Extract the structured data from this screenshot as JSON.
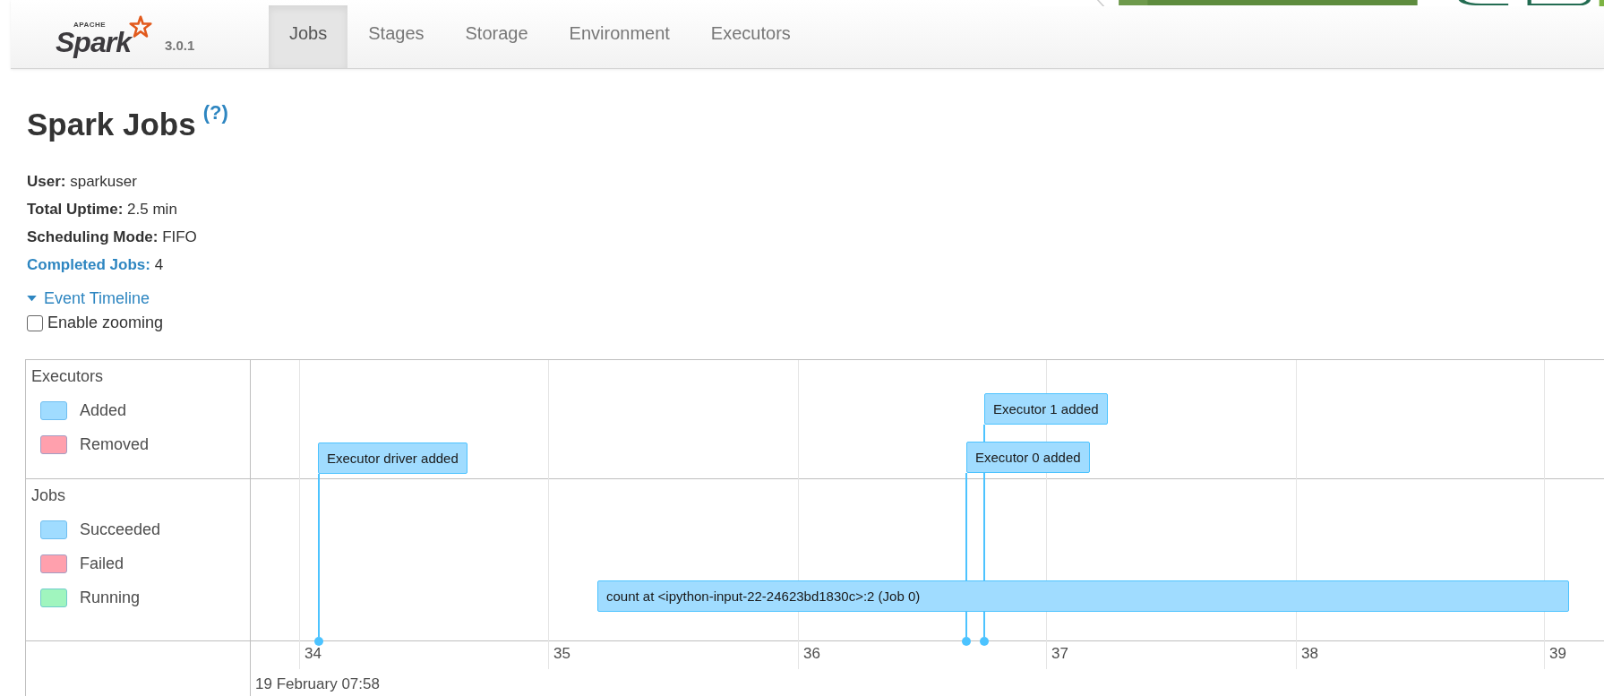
{
  "navbar": {
    "brand": {
      "apache": "APACHE",
      "name": "Spark",
      "version": "3.0.1"
    },
    "tabs": [
      {
        "label": "Jobs",
        "selected": true
      },
      {
        "label": "Stages",
        "selected": false
      },
      {
        "label": "Storage",
        "selected": false
      },
      {
        "label": "Environment",
        "selected": false
      },
      {
        "label": "Executors",
        "selected": false
      }
    ]
  },
  "page": {
    "title": "Spark Jobs",
    "help": "(?)",
    "summary": [
      {
        "label": "User:",
        "value": "sparkuser",
        "kind": "plain"
      },
      {
        "label": "Total Uptime:",
        "value": "2.5 min",
        "kind": "plain"
      },
      {
        "label": "Scheduling Mode:",
        "value": "FIFO",
        "kind": "plain"
      },
      {
        "label": "Completed Jobs:",
        "value": "4",
        "kind": "link"
      }
    ]
  },
  "timeline": {
    "toggle": {
      "label": "Event Timeline",
      "expanded": true
    },
    "zoom_checkbox": {
      "label": "Enable zooming",
      "checked": false
    },
    "groups": [
      {
        "title": "Executors",
        "legend": [
          {
            "label": "Added",
            "color": "#a0dcff"
          },
          {
            "label": "Removed",
            "color": "#ffa0ad"
          }
        ],
        "events": [
          {
            "label": "Executor driver added"
          },
          {
            "label": "Executor 1 added"
          },
          {
            "label": "Executor 0 added"
          }
        ]
      },
      {
        "title": "Jobs",
        "legend": [
          {
            "label": "Succeeded",
            "color": "#a0dcff"
          },
          {
            "label": "Failed",
            "color": "#ffa0ad"
          },
          {
            "label": "Running",
            "color": "#a0f5be"
          }
        ],
        "events": [
          {
            "label": "count at <ipython-input-22-24623bd1830c>:2 (Job 0)"
          }
        ]
      }
    ],
    "axis": {
      "ticks": [
        "34",
        "35",
        "36",
        "37",
        "38",
        "39"
      ],
      "date": "19 February 07:58"
    }
  }
}
